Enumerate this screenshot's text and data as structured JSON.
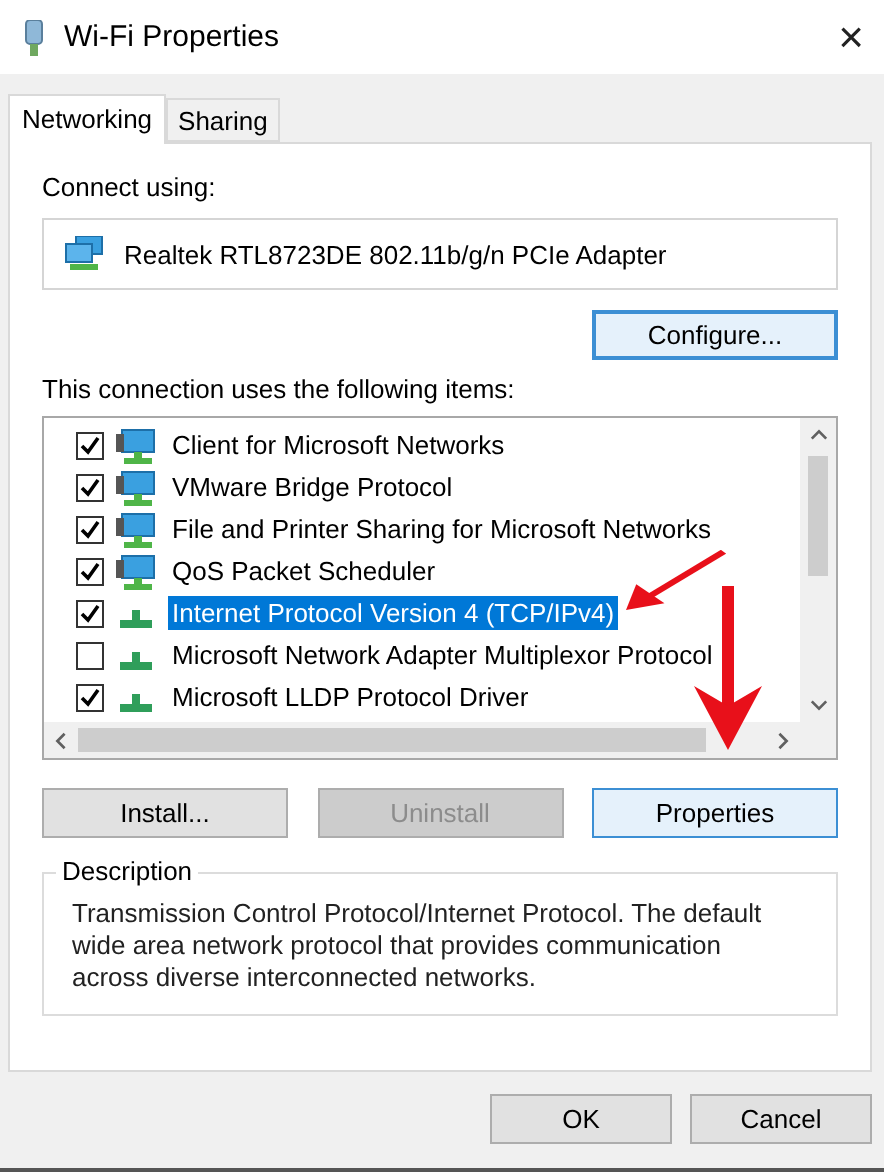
{
  "window": {
    "title": "Wi-Fi Properties",
    "close": "×"
  },
  "tabs": [
    {
      "label": "Networking",
      "selected": true
    },
    {
      "label": "Sharing",
      "selected": false
    }
  ],
  "connect_using": {
    "label": "Connect using:",
    "adapter": "Realtek RTL8723DE 802.11b/g/n PCIe Adapter",
    "configure": {
      "label": "Configure...",
      "focused": true
    }
  },
  "items_label": "This connection uses the following items:",
  "items": [
    {
      "label": "Client for Microsoft Networks",
      "checked": true,
      "selected": false,
      "kind": "computer"
    },
    {
      "label": "VMware Bridge Protocol",
      "checked": true,
      "selected": false,
      "kind": "computer"
    },
    {
      "label": "File and Printer Sharing for Microsoft Networks",
      "checked": true,
      "selected": false,
      "kind": "computer"
    },
    {
      "label": "QoS Packet Scheduler",
      "checked": true,
      "selected": false,
      "kind": "computer"
    },
    {
      "label": "Internet Protocol Version 4 (TCP/IPv4)",
      "checked": true,
      "selected": true,
      "kind": "protocol"
    },
    {
      "label": "Microsoft Network Adapter Multiplexor Protocol",
      "checked": false,
      "selected": false,
      "kind": "protocol"
    },
    {
      "label": "Microsoft LLDP Protocol Driver",
      "checked": true,
      "selected": false,
      "kind": "protocol"
    }
  ],
  "item_buttons": [
    {
      "label": "Install...",
      "disabled": false,
      "focused": false
    },
    {
      "label": "Uninstall",
      "disabled": true,
      "focused": false
    },
    {
      "label": "Properties",
      "disabled": false,
      "focused": true
    }
  ],
  "description": {
    "title": "Description",
    "text": "Transmission Control Protocol/Internet Protocol. The default wide area network protocol that provides communication across diverse interconnected networks."
  },
  "dialog_buttons": [
    {
      "label": "OK",
      "disabled": false,
      "focused": false
    },
    {
      "label": "Cancel",
      "disabled": false,
      "focused": false
    }
  ]
}
